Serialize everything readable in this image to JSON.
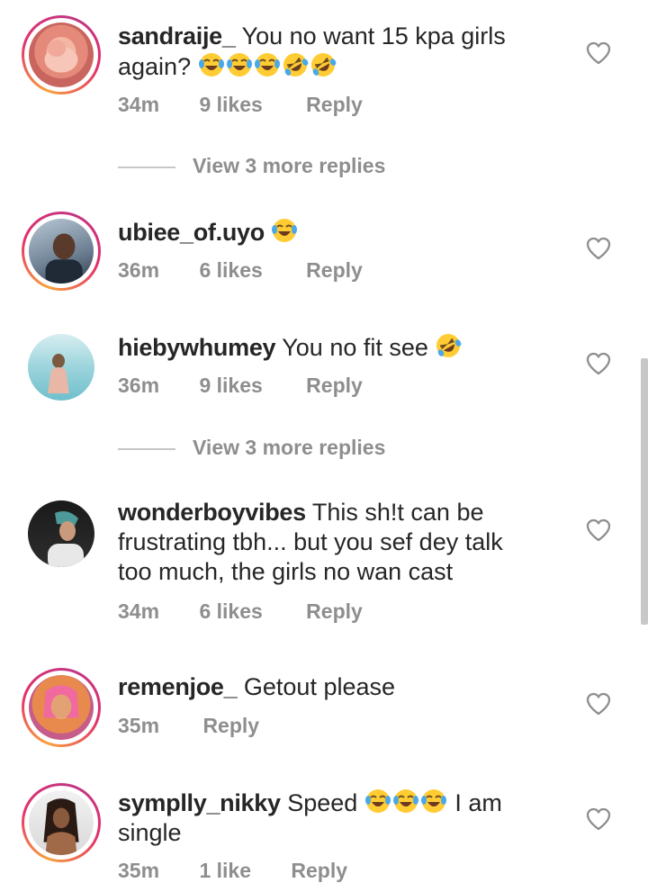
{
  "comments": [
    {
      "username": "sandraije_",
      "text": "You no want 15 kpa girls again?",
      "emojis": [
        "joy",
        "joy",
        "joy",
        "rofl",
        "rofl"
      ],
      "time": "34m",
      "likes": "9 likes",
      "reply": "Reply",
      "avatar_ring": true
    },
    {
      "username": "ubiee_of.uyo",
      "text": "",
      "emojis": [
        "joy"
      ],
      "time": "36m",
      "likes": "6 likes",
      "reply": "Reply",
      "avatar_ring": true
    },
    {
      "username": "hiebywhumey",
      "text": "You no fit see",
      "emojis": [
        "rofl"
      ],
      "time": "36m",
      "likes": "9 likes",
      "reply": "Reply",
      "avatar_ring": false
    },
    {
      "username": "wonderboyvibes",
      "text": "This sh!t can be frustrating tbh...  but you sef dey talk too much, the girls no wan cast",
      "emojis": [],
      "time": "34m",
      "likes": "6 likes",
      "reply": "Reply",
      "avatar_ring": false
    },
    {
      "username": "remenjoe_",
      "text": "Getout please",
      "emojis": [],
      "time": "35m",
      "likes": "",
      "reply": "Reply",
      "avatar_ring": true
    },
    {
      "username": "symplly_nikky",
      "text_before": "Speed",
      "emojis": [
        "joy",
        "joy",
        "joy"
      ],
      "text_after": "I am single",
      "time": "35m",
      "likes": "1 like",
      "reply": "Reply",
      "avatar_ring": true
    }
  ],
  "view_more": [
    "View 3 more replies",
    "View 3 more replies"
  ],
  "icons": {
    "like": "heart-outline-icon"
  },
  "colors": {
    "text": "#262626",
    "secondary": "#8e8e8e",
    "ring_start": "#f9a13b",
    "ring_end": "#c13584"
  }
}
